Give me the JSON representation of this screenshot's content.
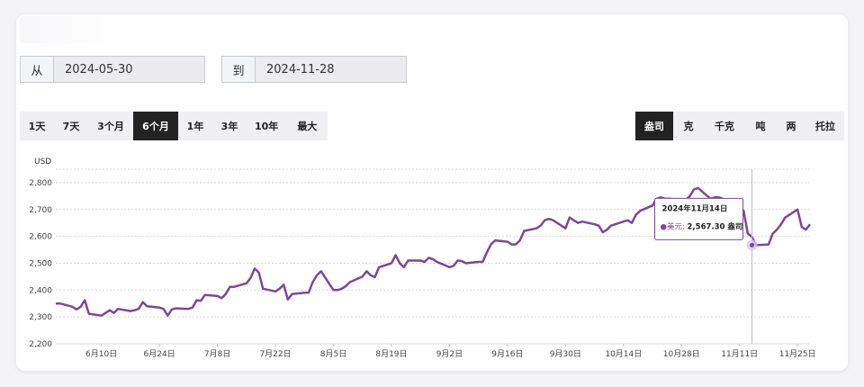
{
  "from_date": {
    "label": "从",
    "value": "2024-05-30"
  },
  "to_date": {
    "label": "到",
    "value": "2024-11-28"
  },
  "ranges": [
    "1天",
    "7天",
    "3个月",
    "6个月",
    "1年",
    "3年",
    "10年",
    "最大"
  ],
  "active_range": 3,
  "units": [
    "盎司",
    "克",
    "千克",
    "吨",
    "两",
    "托拉"
  ],
  "active_unit": 0,
  "colors": {
    "line": "#7a4a96",
    "grid": "#d9d9d9",
    "active": "#222222"
  },
  "tooltip": {
    "date": "2024年11月14日",
    "series_label": "●美元:",
    "value_text": "2,567.30 盎司",
    "value": 2567.3
  },
  "chart_data": {
    "type": "line",
    "ylabel": "USD",
    "ylim": [
      2200,
      2850
    ],
    "yticks": [
      2200,
      2300,
      2400,
      2500,
      2600,
      2700,
      2800
    ],
    "ytick_labels": [
      "2,200",
      "2,300",
      "2,400",
      "2,500",
      "2,600",
      "2,700",
      "2,800"
    ],
    "xlim": [
      "2024-05-30",
      "2024-11-28"
    ],
    "xticks": [
      "2024-06-10",
      "2024-06-24",
      "2024-07-08",
      "2024-07-22",
      "2024-08-05",
      "2024-08-19",
      "2024-09-02",
      "2024-09-16",
      "2024-09-30",
      "2024-10-14",
      "2024-10-28",
      "2024-11-11",
      "2024-11-25"
    ],
    "xtick_labels": [
      "6月10日",
      "6月24日",
      "7月8日",
      "7月22日",
      "8月5日",
      "8月19日",
      "9月2日",
      "9月16日",
      "9月30日",
      "10月14日",
      "10月28日",
      "11月11日",
      "11月25日"
    ],
    "grid": true,
    "highlight_date": "2024-11-14",
    "x": [
      "2024-05-30",
      "2024-05-31",
      "2024-06-03",
      "2024-06-04",
      "2024-06-05",
      "2024-06-06",
      "2024-06-07",
      "2024-06-10",
      "2024-06-11",
      "2024-06-12",
      "2024-06-13",
      "2024-06-14",
      "2024-06-17",
      "2024-06-18",
      "2024-06-19",
      "2024-06-20",
      "2024-06-21",
      "2024-06-24",
      "2024-06-25",
      "2024-06-26",
      "2024-06-27",
      "2024-06-28",
      "2024-07-01",
      "2024-07-02",
      "2024-07-03",
      "2024-07-04",
      "2024-07-05",
      "2024-07-08",
      "2024-07-09",
      "2024-07-10",
      "2024-07-11",
      "2024-07-12",
      "2024-07-15",
      "2024-07-16",
      "2024-07-17",
      "2024-07-18",
      "2024-07-19",
      "2024-07-22",
      "2024-07-23",
      "2024-07-24",
      "2024-07-25",
      "2024-07-26",
      "2024-07-29",
      "2024-07-30",
      "2024-07-31",
      "2024-08-01",
      "2024-08-02",
      "2024-08-05",
      "2024-08-06",
      "2024-08-07",
      "2024-08-08",
      "2024-08-09",
      "2024-08-12",
      "2024-08-13",
      "2024-08-14",
      "2024-08-15",
      "2024-08-16",
      "2024-08-19",
      "2024-08-20",
      "2024-08-21",
      "2024-08-22",
      "2024-08-23",
      "2024-08-26",
      "2024-08-27",
      "2024-08-28",
      "2024-08-29",
      "2024-08-30",
      "2024-09-02",
      "2024-09-03",
      "2024-09-04",
      "2024-09-05",
      "2024-09-06",
      "2024-09-09",
      "2024-09-10",
      "2024-09-11",
      "2024-09-12",
      "2024-09-13",
      "2024-09-16",
      "2024-09-17",
      "2024-09-18",
      "2024-09-19",
      "2024-09-20",
      "2024-09-23",
      "2024-09-24",
      "2024-09-25",
      "2024-09-26",
      "2024-09-27",
      "2024-09-30",
      "2024-10-01",
      "2024-10-02",
      "2024-10-03",
      "2024-10-04",
      "2024-10-07",
      "2024-10-08",
      "2024-10-09",
      "2024-10-10",
      "2024-10-11",
      "2024-10-14",
      "2024-10-15",
      "2024-10-16",
      "2024-10-17",
      "2024-10-18",
      "2024-10-21",
      "2024-10-22",
      "2024-10-23",
      "2024-10-24",
      "2024-10-25",
      "2024-10-28",
      "2024-10-29",
      "2024-10-30",
      "2024-10-31",
      "2024-11-01",
      "2024-11-04",
      "2024-11-05",
      "2024-11-06",
      "2024-11-07",
      "2024-11-08",
      "2024-11-11",
      "2024-11-12",
      "2024-11-13",
      "2024-11-14",
      "2024-11-15",
      "2024-11-18",
      "2024-11-19",
      "2024-11-20",
      "2024-11-21",
      "2024-11-22",
      "2024-11-25",
      "2024-11-26",
      "2024-11-27",
      "2024-11-28"
    ],
    "series": [
      {
        "values": [
          2350,
          2350,
          2338,
          2328,
          2338,
          2362,
          2312,
          2305,
          2315,
          2325,
          2315,
          2330,
          2322,
          2325,
          2330,
          2355,
          2340,
          2335,
          2330,
          2305,
          2328,
          2332,
          2330,
          2335,
          2362,
          2360,
          2382,
          2378,
          2370,
          2385,
          2412,
          2412,
          2425,
          2445,
          2480,
          2465,
          2405,
          2395,
          2405,
          2420,
          2365,
          2385,
          2390,
          2390,
          2430,
          2455,
          2470,
          2400,
          2400,
          2405,
          2415,
          2430,
          2450,
          2470,
          2455,
          2448,
          2485,
          2500,
          2530,
          2500,
          2485,
          2510,
          2510,
          2505,
          2520,
          2515,
          2505,
          2485,
          2490,
          2510,
          2508,
          2500,
          2505,
          2505,
          2540,
          2570,
          2585,
          2580,
          2570,
          2570,
          2585,
          2620,
          2630,
          2640,
          2660,
          2665,
          2660,
          2630,
          2670,
          2660,
          2650,
          2655,
          2645,
          2640,
          2615,
          2625,
          2640,
          2655,
          2660,
          2650,
          2680,
          2695,
          2715,
          2740,
          2745,
          2740,
          2740,
          2735,
          2735,
          2750,
          2775,
          2780,
          2740,
          2745,
          2745,
          2740,
          2660,
          2695,
          2695,
          2610,
          2598,
          2567.3,
          2570,
          2610,
          2625,
          2645,
          2670,
          2700,
          2635,
          2625,
          2645,
          2645
        ]
      }
    ]
  }
}
